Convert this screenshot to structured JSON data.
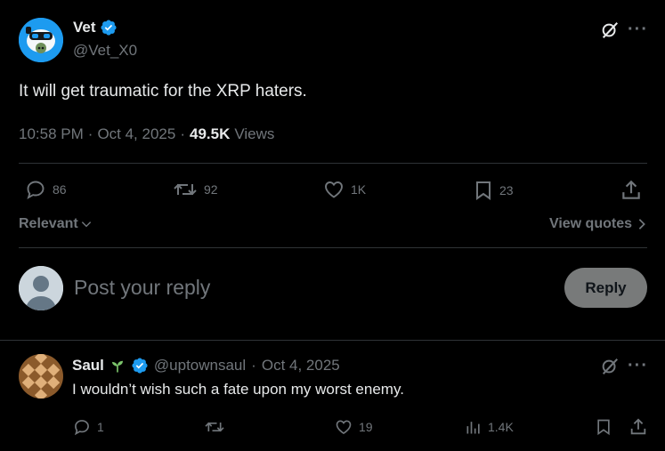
{
  "post": {
    "author_name": "Vet",
    "author_handle": "@Vet_X0",
    "text": "It will get traumatic for the XRP haters.",
    "time": "10:58 PM",
    "sep1": "·",
    "date": "Oct 4, 2025",
    "sep2": "·",
    "views_count": "49.5K",
    "views_label": "Views",
    "replies": "86",
    "reposts": "92",
    "likes": "1K",
    "bookmarks": "23"
  },
  "filters": {
    "sort_label": "Relevant",
    "view_quotes_label": "View quotes"
  },
  "composer": {
    "placeholder": "Post your reply",
    "reply_button": "Reply"
  },
  "reply": {
    "author_name": "Saul",
    "author_handle": "@uptownsaul",
    "sep": "·",
    "date": "Oct 4, 2025",
    "text": "I wouldn’t wish such a fate upon my worst enemy.",
    "replies": "1",
    "likes": "19",
    "views": "1.4K"
  },
  "icons": {
    "verified": "verified-badge-icon",
    "grok": "grok-icon",
    "more": "more-icon",
    "reply": "reply-icon",
    "repost": "repost-icon",
    "like": "heart-icon",
    "bookmark": "bookmark-icon",
    "share": "share-icon",
    "views": "views-icon",
    "seedling": "seedling-icon",
    "more_glyph": "···"
  },
  "colors": {
    "background": "#000000",
    "text": "#e7e9ea",
    "muted": "#71767b",
    "verified": "#1d9bf0",
    "divider": "#2f3336"
  }
}
